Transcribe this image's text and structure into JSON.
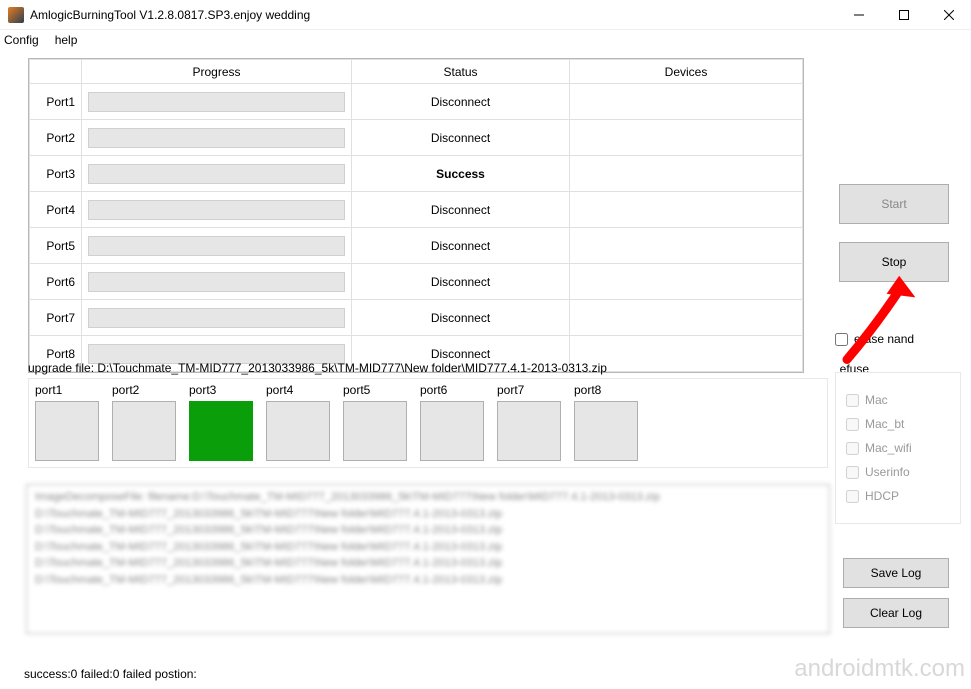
{
  "window": {
    "title": "AmlogicBurningTool  V1.2.8.0817.SP3.enjoy wedding"
  },
  "menu": {
    "config": "Config",
    "help": "help"
  },
  "table": {
    "headers": {
      "progress": "Progress",
      "status": "Status",
      "devices": "Devices"
    },
    "rows": [
      {
        "port": "Port1",
        "status": "Disconnect",
        "success": false
      },
      {
        "port": "Port2",
        "status": "Disconnect",
        "success": false
      },
      {
        "port": "Port3",
        "status": "Success",
        "success": true
      },
      {
        "port": "Port4",
        "status": "Disconnect",
        "success": false
      },
      {
        "port": "Port5",
        "status": "Disconnect",
        "success": false
      },
      {
        "port": "Port6",
        "status": "Disconnect",
        "success": false
      },
      {
        "port": "Port7",
        "status": "Disconnect",
        "success": false
      },
      {
        "port": "Port8",
        "status": "Disconnect",
        "success": false
      }
    ]
  },
  "upgrade_file": "upgrade file: D:\\Touchmate_TM-MID777_2013033986_5k\\TM-MID777\\New folder\\MID777.4.1-2013-0313.zip",
  "port_boxes": [
    {
      "label": "port1",
      "green": false
    },
    {
      "label": "port2",
      "green": false
    },
    {
      "label": "port3",
      "green": true
    },
    {
      "label": "port4",
      "green": false
    },
    {
      "label": "port5",
      "green": false
    },
    {
      "label": "port6",
      "green": false
    },
    {
      "label": "port7",
      "green": false
    },
    {
      "label": "port8",
      "green": false
    }
  ],
  "log_lines": [
    "ImageDecomposeFile:    filename:D:\\Touchmate_TM-MID777_2013033986_5k\\TM-MID777\\New folder\\MID777.4.1-2013-0313.zip",
    "D:\\Touchmate_TM-MID777_2013033986_5k\\TM-MID777\\New folder\\MID777.4.1-2013-0313.zip",
    "D:\\Touchmate_TM-MID777_2013033986_5k\\TM-MID777\\New folder\\MID777.4.1-2013-0313.zip",
    "D:\\Touchmate_TM-MID777_2013033986_5k\\TM-MID777\\New folder\\MID777.4.1-2013-0313.zip",
    "D:\\Touchmate_TM-MID777_2013033986_5k\\TM-MID777\\New folder\\MID777.4.1-2013-0313.zip",
    "D:\\Touchmate_TM-MID777_2013033986_5k\\TM-MID777\\New folder\\MID777.4.1-2013-0313.zip"
  ],
  "status_bar": "success:0 failed:0 failed postion:",
  "buttons": {
    "start": "Start",
    "stop": "Stop",
    "save_log": "Save Log",
    "clear_log": "Clear Log"
  },
  "checkboxes": {
    "erase_nand": "erase nand"
  },
  "efuse": {
    "title": "efuse",
    "mac": "Mac",
    "mac_bt": "Mac_bt",
    "mac_wifi": "Mac_wifi",
    "userinfo": "Userinfo",
    "hdcp": "HDCP"
  },
  "watermark": "androidmtk.com"
}
